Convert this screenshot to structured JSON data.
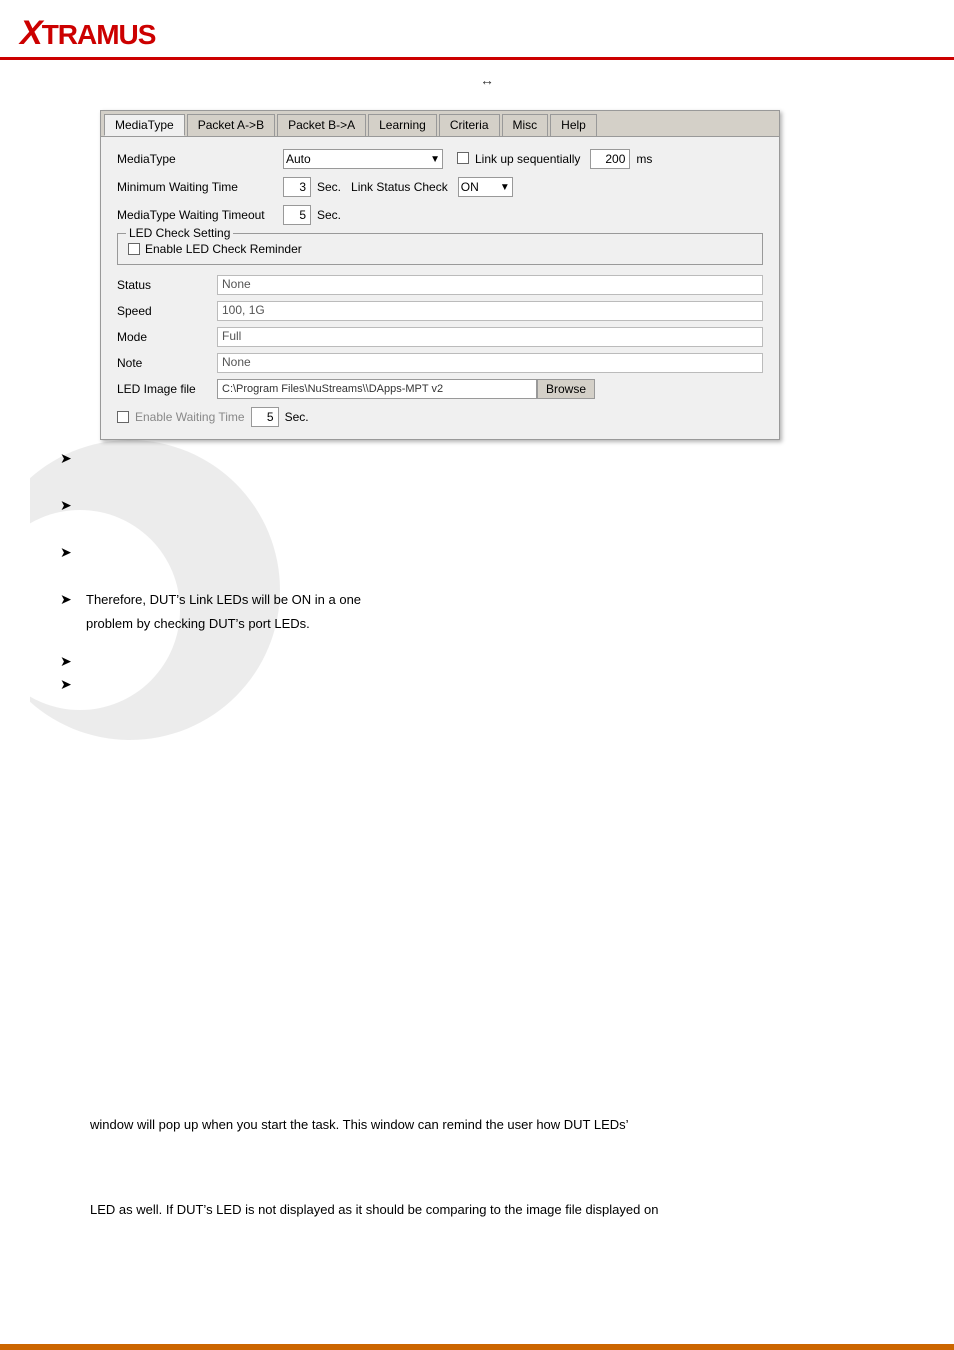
{
  "header": {
    "logo_x": "X",
    "logo_rest": "TRAMUS"
  },
  "header_arrow": "↔",
  "tabs": [
    {
      "label": "MediaType",
      "active": true
    },
    {
      "label": "Packet A->B",
      "active": false
    },
    {
      "label": "Packet B->A",
      "active": false
    },
    {
      "label": "Learning",
      "active": false
    },
    {
      "label": "Criteria",
      "active": false
    },
    {
      "label": "Misc",
      "active": false
    },
    {
      "label": "Help",
      "active": false
    }
  ],
  "fields": {
    "mediatype_label": "MediaType",
    "mediatype_value": "Auto",
    "link_sequential_label": "Link up sequentially",
    "link_sequential_ms": "200",
    "link_sequential_unit": "ms",
    "min_wait_label": "Minimum Waiting Time",
    "min_wait_value": "3",
    "min_wait_unit": "Sec.",
    "link_status_label": "Link Status Check",
    "link_status_value": "ON",
    "mediatype_timeout_label": "MediaType Waiting Timeout",
    "mediatype_timeout_value": "5",
    "mediatype_timeout_unit": "Sec.",
    "led_check_group_label": "LED Check Setting",
    "enable_led_label": "Enable LED Check Reminder",
    "status_label": "Status",
    "status_value": "None",
    "speed_label": "Speed",
    "speed_value": "100, 1G",
    "mode_label": "Mode",
    "mode_value": "Full",
    "note_label": "Note",
    "note_value": "None",
    "led_image_label": "LED Image file",
    "led_image_path": "C:\\Program Files\\NuStreams\\\\DApps-MPT v2",
    "browse_label": "Browse",
    "enable_waiting_label": "Enable Waiting Time",
    "enable_waiting_value": "5",
    "enable_waiting_unit": "Sec."
  },
  "bullets": [
    {
      "text": ""
    },
    {
      "text": ""
    },
    {
      "text": ""
    },
    {
      "text": "Therefore, DUT’s Link LEDs will be ON in a one"
    },
    {
      "text": "problem by checking DUT’s port LEDs."
    },
    {
      "text": ""
    },
    {
      "text": ""
    }
  ],
  "text_block1": "window will pop up when you start the task. This window can remind the user how DUT LEDs’",
  "text_block2": "LED as well. If DUT’s LED is not displayed as it should be comparing to the image file displayed on"
}
